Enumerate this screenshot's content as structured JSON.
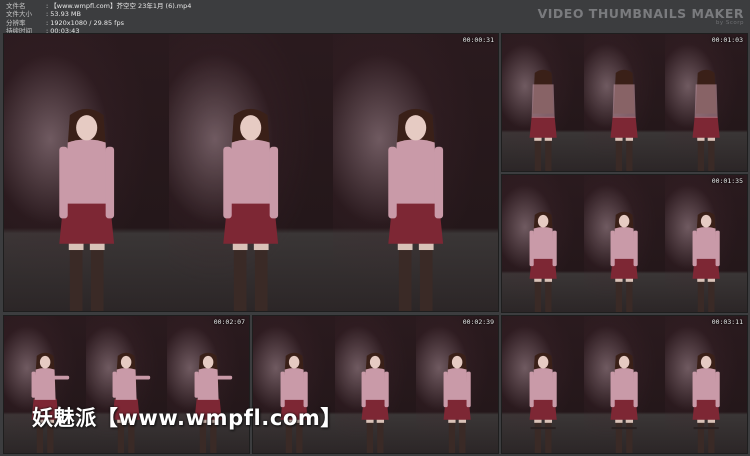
{
  "file_info": [
    {
      "key": "文件名",
      "value": ": 【www.wmpfl.com】芥空空 23年1月 (6).mp4"
    },
    {
      "key": "文件大小",
      "value": ": 53.93 MB"
    },
    {
      "key": "分辨率",
      "value": ": 1920x1080 / 29.85 fps"
    },
    {
      "key": "持续时间",
      "value": ": 00:03:43"
    }
  ],
  "brand": {
    "title": "VIDEO THUMBNAILS MAKER",
    "subtitle": "by Scorp"
  },
  "thumbnails": [
    {
      "timestamp": "00:00:31"
    },
    {
      "timestamp": "00:01:03"
    },
    {
      "timestamp": "00:01:35"
    },
    {
      "timestamp": "00:02:07"
    },
    {
      "timestamp": "00:02:39"
    },
    {
      "timestamp": "00:03:11"
    }
  ],
  "watermark": "妖魅派【www.wmpfl.com】",
  "colors": {
    "background": "#3c3d3f",
    "scene_dark": "#1d1416",
    "top_pink": "#c99aa8",
    "skirt": "#7d2734",
    "hair": "#3a2018",
    "legs": "#3a2a26"
  }
}
